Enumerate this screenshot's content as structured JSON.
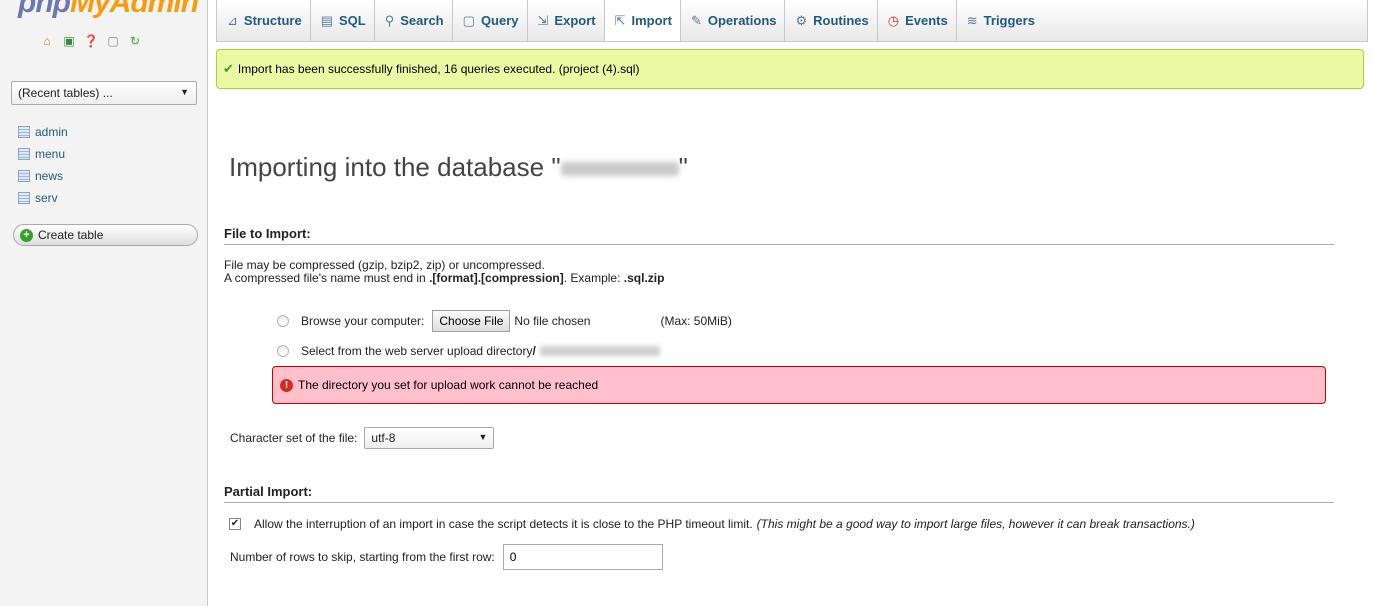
{
  "sidebar": {
    "logo_php": "php",
    "logo_myadmin": "MyAdmin",
    "recent_tables": "(Recent tables) ...",
    "tables": [
      "admin",
      "menu",
      "news",
      "serv"
    ],
    "create_table": "Create table",
    "icons": [
      "home-icon",
      "exit-icon",
      "help-icon",
      "docs-icon",
      "reload-icon"
    ]
  },
  "tabs": [
    {
      "label": "Structure",
      "icon": "structure-icon"
    },
    {
      "label": "SQL",
      "icon": "sql-icon"
    },
    {
      "label": "Search",
      "icon": "search-icon"
    },
    {
      "label": "Query",
      "icon": "query-icon"
    },
    {
      "label": "Export",
      "icon": "export-icon"
    },
    {
      "label": "Import",
      "icon": "import-icon",
      "active": true
    },
    {
      "label": "Operations",
      "icon": "operations-icon"
    },
    {
      "label": "Routines",
      "icon": "routines-icon"
    },
    {
      "label": "Events",
      "icon": "events-icon"
    },
    {
      "label": "Triggers",
      "icon": "triggers-icon"
    }
  ],
  "success_message": "Import has been successfully finished, 16 queries executed. (project (4).sql)",
  "page_title": "Importing into the database \"",
  "page_title_end": "\"",
  "file_section": {
    "heading": "File to Import:",
    "desc_line1": "File may be compressed (gzip, bzip2, zip) or uncompressed.",
    "desc_line2_a": "A compressed file's name must end in ",
    "desc_line2_b": ".[format].[compression]",
    "desc_line2_c": ". Example: ",
    "desc_line2_d": ".sql.zip",
    "browse_label": "Browse your computer:",
    "choose_file": "Choose File",
    "no_file": "No file chosen",
    "max_size": "(Max: 50MiB)",
    "upload_dir_label": "Select from the web server upload directory ",
    "upload_dir_prefix": "/",
    "error": "The directory you set for upload work cannot be reached"
  },
  "charset": {
    "label": "Character set of the file:",
    "value": "utf-8"
  },
  "partial": {
    "heading": "Partial Import:",
    "allow_label": "Allow the interruption of an import in case the script detects it is close to the PHP timeout limit.",
    "allow_note": "(This might be a good way to import large files, however it can break transactions.)",
    "allow_checked": true,
    "skip_label": "Number of rows to skip, starting from the first row:",
    "skip_value": "0"
  },
  "colors": {
    "success_bg": "#ebf8a4",
    "error_bg": "#ffc0cb",
    "link": "#235a81"
  }
}
